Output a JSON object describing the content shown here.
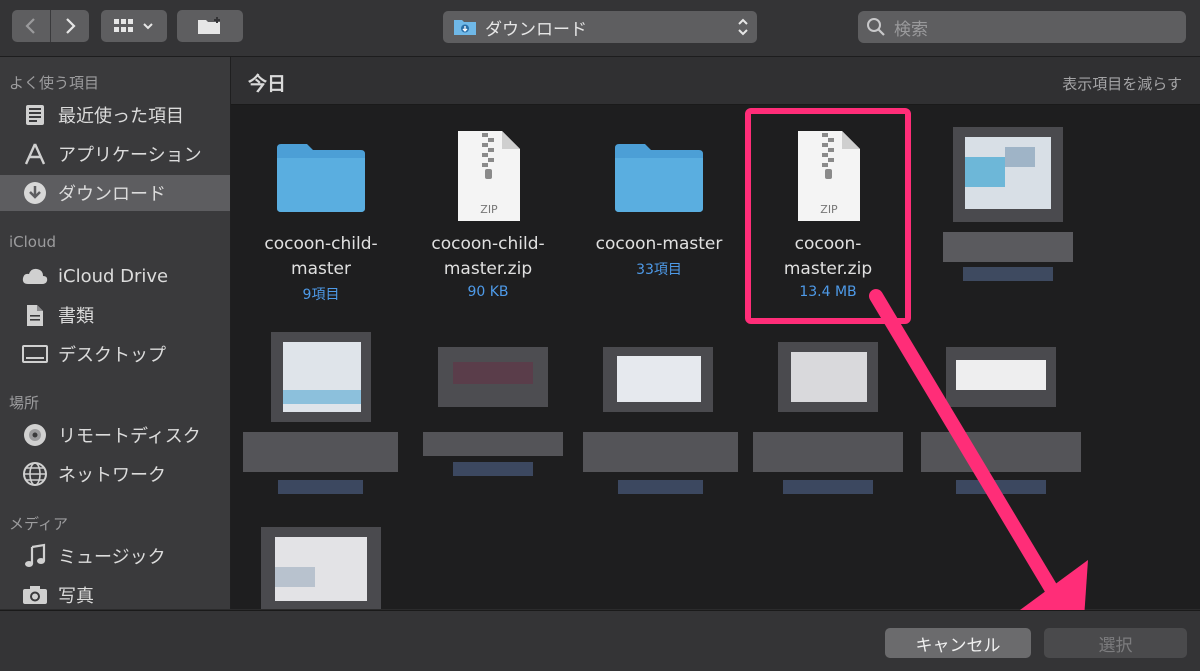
{
  "toolbar": {
    "back_icon": "chevron-left-icon",
    "forward_icon": "chevron-right-icon",
    "view_icon": "grid-view-icon",
    "new_folder_icon": "new-folder-icon",
    "path_label": "ダウンロード",
    "search_placeholder": "検索"
  },
  "sidebar": {
    "sections": [
      {
        "title": "よく使う項目",
        "items": [
          {
            "label": "最近使った項目",
            "icon": "recents-icon"
          },
          {
            "label": "アプリケーション",
            "icon": "applications-icon"
          },
          {
            "label": "ダウンロード",
            "icon": "downloads-icon",
            "selected": true
          }
        ]
      },
      {
        "title": "iCloud",
        "items": [
          {
            "label": "iCloud Drive",
            "icon": "cloud-icon"
          },
          {
            "label": "書類",
            "icon": "document-icon"
          },
          {
            "label": "デスクトップ",
            "icon": "desktop-icon"
          }
        ]
      },
      {
        "title": "場所",
        "items": [
          {
            "label": "リモートディスク",
            "icon": "disc-icon"
          },
          {
            "label": "ネットワーク",
            "icon": "network-icon"
          }
        ]
      },
      {
        "title": "メディア",
        "items": [
          {
            "label": "ミュージック",
            "icon": "music-icon"
          },
          {
            "label": "写真",
            "icon": "camera-icon"
          }
        ]
      }
    ]
  },
  "main": {
    "title": "今日",
    "show_less": "表示項目を減らす",
    "files": [
      {
        "name1": "cocoon-child-",
        "name2": "master",
        "meta": "9項目",
        "type": "folder"
      },
      {
        "name1": "cocoon-child-",
        "name2": "master.zip",
        "meta": "90 KB",
        "type": "zip",
        "badge": "ZIP"
      },
      {
        "name1": "cocoon-master",
        "name2": "",
        "meta": "33項目",
        "type": "folder"
      },
      {
        "name1": "cocoon-",
        "name2": "master.zip",
        "meta": "13.4 MB",
        "type": "zip",
        "badge": "ZIP",
        "highlighted": true
      }
    ]
  },
  "footer": {
    "cancel_label": "キャンセル",
    "select_label": "選択"
  },
  "colors": {
    "accent_blue": "#4e9ae8",
    "highlight_pink": "#ff2d78",
    "folder_blue": "#5aaee0"
  }
}
